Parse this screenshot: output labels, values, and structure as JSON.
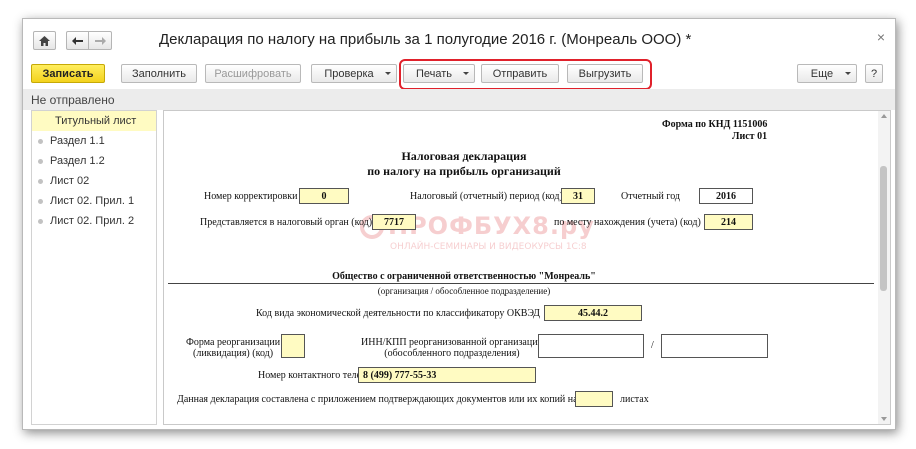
{
  "window": {
    "title": "Декларация по налогу на прибыль за 1 полугодие 2016 г. (Монреаль ООО) *",
    "close_glyph": "×",
    "home_icon": "home-icon",
    "back_icon": "arrow-left-icon",
    "forward_icon": "arrow-right-icon"
  },
  "toolbar": {
    "save": "Записать",
    "fill": "Заполнить",
    "decode": "Расшифровать",
    "check": "Проверка",
    "print": "Печать",
    "send": "Отправить",
    "upload": "Выгрузить",
    "more": "Еще",
    "help": "?"
  },
  "status": {
    "text": "Не отправлено"
  },
  "sidebar": {
    "items": [
      {
        "label": "Титульный лист",
        "active": true
      },
      {
        "label": "Раздел 1.1"
      },
      {
        "label": "Раздел 1.2"
      },
      {
        "label": "Лист 02"
      },
      {
        "label": "Лист 02. Прил. 1"
      },
      {
        "label": "Лист 02. Прил. 2"
      }
    ]
  },
  "form": {
    "knd": "Форма по КНД 1151006",
    "sheet": "Лист 01",
    "title_line1": "Налоговая декларация",
    "title_line2": "по налогу на прибыль организаций",
    "correction_label": "Номер корректировки",
    "correction_value": "0",
    "period_label": "Налоговый (отчетный) период (код)",
    "period_value": "31",
    "year_label": "Отчетный год",
    "year_value": "2016",
    "authority_label": "Представляется в налоговый орган (код)",
    "authority_value": "7717",
    "location_label": "по месту нахождения (учета) (код)",
    "location_value": "214",
    "org_name": "Общество с ограниченной ответственностью \"Монреаль\"",
    "org_caption": "(организация / обособленное подразделение)",
    "okved_label": "Код вида экономической деятельности по классификатору ОКВЭД",
    "okved_value": "45.44.2",
    "reorg_label_1": "Форма реорганизации",
    "reorg_label_2": "(ликвидация) (код)",
    "reorg_value": "",
    "inn_label_1": "ИНН/КПП реорганизованной организации",
    "inn_label_2": "(обособленного подразделения)",
    "inn_value": "",
    "slash": "/",
    "kpp_value": "",
    "phone_label": "Номер контактного телефона",
    "phone_value": "8 (499) 777-55-33",
    "attach_label": "Данная декларация составлена с приложением подтверждающих документов или их копий на",
    "attach_value": "",
    "attach_unit": "листах"
  },
  "watermark": {
    "main": "ПРОФБУХ8.ру",
    "sub": "ОНЛАЙН-СЕМИНАРЫ И ВИДЕОКУРСЫ 1С:8"
  }
}
